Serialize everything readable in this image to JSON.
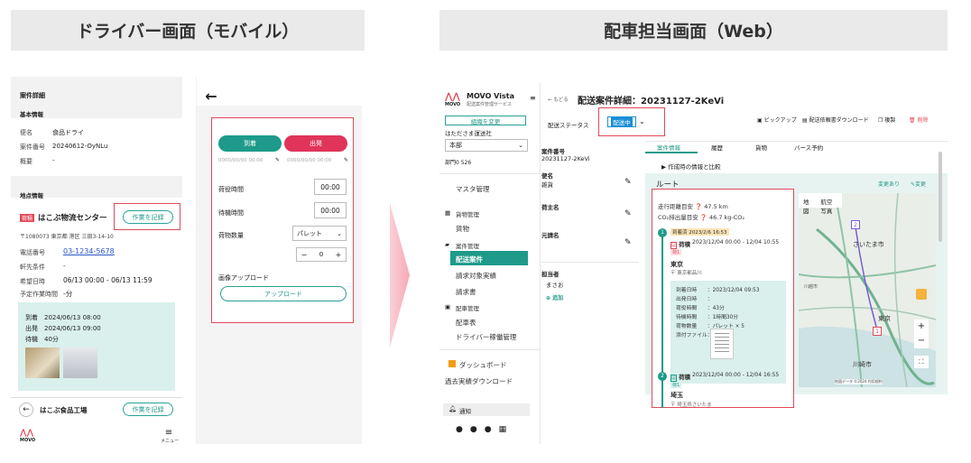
{
  "headers": {
    "left": "ドライバー画面（モバイル）",
    "right": "配車担当画面（Web）"
  },
  "mobile1": {
    "title": "案件詳細",
    "basic_info": "基本情報",
    "flight_label": "便名",
    "flight_value": "食品ドライ",
    "case_no_label": "案件番号",
    "case_no_value": "20240612-OyNLu",
    "summary_label": "概要",
    "summary_value": "-",
    "location_info": "地点情報",
    "badge": "荷積",
    "company": "はこぶ物流センター",
    "record_btn": "作業を記録",
    "address": "〒1080073 東京都 港区 三田3-14-10",
    "phone_label": "電話番号",
    "phone_value": "03-1234-5678",
    "eave_label": "軒先条件",
    "eave_value": "-",
    "desired_label": "希望日時",
    "desired_value": "06/13 00:00 - 06/13 11:59",
    "planned_label": "予定作業時間",
    "planned_value": "-分",
    "arrival": "到着　2024/06/13 08:00",
    "departure": "出発　2024/06/13 09:00",
    "wait": "待機　40分",
    "next_company": "はこぶ食品工場",
    "next_record_btn": "作業を記録",
    "logo": "MOVO",
    "menu": "メニュー"
  },
  "mobile2": {
    "arrive_btn": "到着",
    "depart_btn": "出発",
    "time_placeholder1": "0000/00/00 00:00",
    "time_placeholder2": "0000/00/00 00:00",
    "loading_label": "荷役時間",
    "loading_value": "00:00",
    "waiting_label": "待機時間",
    "waiting_value": "00:00",
    "qty_label": "荷物数量",
    "qty_unit": "パレット",
    "qty_value": "0",
    "image_label": "画像アップロード",
    "upload_btn": "アップロード"
  },
  "web": {
    "logo": "MOVO",
    "brand": "MOVO Vista",
    "brand_sub": "配送案件管理サービス",
    "org_btn": "組織を変更",
    "company": "はたださま運送社",
    "dept": "本部",
    "postal": "部門0 526",
    "nav": [
      "マスタ管理",
      "貨物管理",
      "貨物",
      "案件管理",
      "配送案件",
      "請求対象実績",
      "請求書",
      "配車管理",
      "配車表",
      "ドライバー稼働管理",
      "ダッシュボード",
      "過去実績ダウンロード"
    ],
    "notify": "通知",
    "back": "← もどる",
    "page_title": "配送案件詳細：20231127-2KeVi",
    "status_label": "配送ステータス",
    "status_value": "配送中",
    "actions": {
      "pickup": "ピックアップ",
      "download": "配送依頼書ダウンロード",
      "copy": "複製",
      "delete": "削除"
    },
    "info": {
      "case_label": "案件番号",
      "case_value": "20231127-2KeVi",
      "flight_label": "便名",
      "flight_value": "雑貨",
      "shipper_label": "荷主名",
      "contractor_label": "元請名",
      "person_label": "担当者",
      "person_value": "まさお",
      "add": "追加"
    },
    "tabs": [
      "案件情報",
      "履歴",
      "貨物",
      "バース予約"
    ],
    "compare": "作成時の情報と比較",
    "route_title": "ルート",
    "changed": "変更あり",
    "edit": "変更",
    "distance": "走行距離目安 ❓ 47.5 km",
    "co2": "CO₂排出量目安 ❓ 46.7 kg-CO₂",
    "stop1": {
      "num": "1",
      "plan": "到着済 2023/2/6 16:53",
      "type": "荷積",
      "time": "2023/12/04 00:00 - 12/04 10:55",
      "tag": "荷1",
      "city": "東京",
      "addr": "〒 東京都品川",
      "arr": "到着日時　　：2023/12/04 09:53",
      "dep": "出発日時　　：",
      "load": "荷役時間　　：43分",
      "wait": "待機時間　　：1時間30分",
      "qty": "荷物数量　　：パレット × 5",
      "file": "添付ファイル："
    },
    "stop2": {
      "num": "2",
      "type": "荷積",
      "time": "2023/12/04 00:00 - 12/04 16:55",
      "tag": "荷1",
      "city": "埼玉",
      "addr": "〒 埼玉県さいたま"
    },
    "map": {
      "tab_map": "地図",
      "tab_sat": "航空写真",
      "city1": "さいたま市",
      "city2": "東京",
      "city3": "川越市",
      "city4": "川崎市",
      "attribution": "地図データ ©2024 利用規約",
      "marker1": "1",
      "marker2": "2"
    }
  },
  "colors": {
    "accent": "#239a88",
    "red": "#e04a5a",
    "navActive": "#1e9a8a",
    "badge": "#e04a5a",
    "statusBlue": "#1a8fd6"
  }
}
